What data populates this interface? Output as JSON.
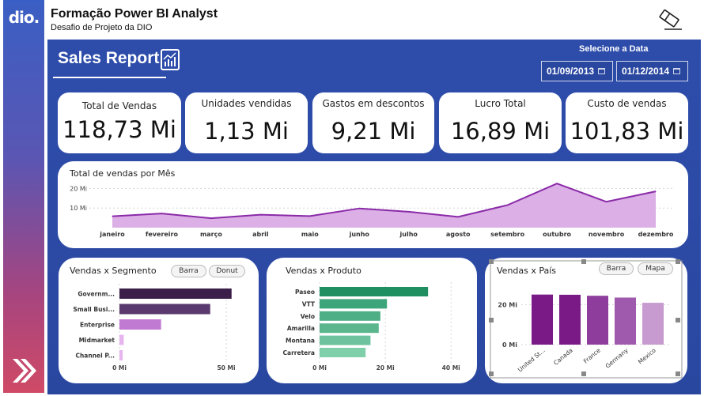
{
  "header": {
    "title": "Formação Power BI Analyst",
    "subtitle": "Desafio de Projeto da DIO",
    "logo_text": "dio."
  },
  "report": {
    "title": "Sales Report"
  },
  "date_filter": {
    "label": "Selecione a Data",
    "start": "01/09/2013",
    "end": "01/12/2014"
  },
  "kpis": [
    {
      "label": "Total de Vendas",
      "value": "118,73 Mi"
    },
    {
      "label": "Unidades vendidas",
      "value": "1,13 Mi"
    },
    {
      "label": "Gastos em descontos",
      "value": "9,21 Mi"
    },
    {
      "label": "Lucro Total",
      "value": "16,89 Mi"
    },
    {
      "label": "Custo de vendas",
      "value": "101,83 Mi"
    }
  ],
  "colors": {
    "accent_purple": "#8a2aa8",
    "area_fill": "#d8a6e3",
    "canvas_blue": "#2c4ba6"
  },
  "chart_data": [
    {
      "type": "area",
      "title": "Total de vendas por Mês",
      "categories": [
        "janeiro",
        "fevereiro",
        "março",
        "abril",
        "maio",
        "junho",
        "julho",
        "agosto",
        "setembro",
        "outubro",
        "novembro",
        "dezembro"
      ],
      "values": [
        5.8,
        7.2,
        4.8,
        6.6,
        5.9,
        9.8,
        8.1,
        5.5,
        11.5,
        22.5,
        13.2,
        18.5
      ],
      "ylim": [
        0,
        25
      ],
      "yticks": [
        {
          "v": 10,
          "label": "10 Mi"
        },
        {
          "v": 20,
          "label": "20 Mi"
        }
      ]
    },
    {
      "type": "bar",
      "orientation": "horizontal",
      "title": "Vendas x Segmento",
      "buttons": [
        "Barra",
        "Donut"
      ],
      "categories": [
        "Governm...",
        "Small Busi...",
        "Enterprise",
        "Midmarket",
        "Channel P..."
      ],
      "values": [
        52.5,
        42.5,
        19.5,
        2.0,
        1.5
      ],
      "colors": [
        "#3b1f4a",
        "#5a3a6e",
        "#c07ad1",
        "#e8b4f0",
        "#e8b4f0"
      ],
      "xlim": [
        0,
        60
      ],
      "xticks": [
        {
          "v": 0,
          "label": "0 Mi"
        },
        {
          "v": 50,
          "label": "50 Mi"
        }
      ]
    },
    {
      "type": "bar",
      "orientation": "horizontal",
      "title": "Vendas x Produto",
      "categories": [
        "Paseo",
        "VTT",
        "Velo",
        "Amarilla",
        "Montana",
        "Carretera"
      ],
      "values": [
        33.0,
        20.5,
        18.5,
        18.0,
        15.5,
        14.0
      ],
      "colors": [
        "#1f8f62",
        "#3da57a",
        "#4eae86",
        "#5bb68e",
        "#6ec39e",
        "#7ecfaa"
      ],
      "xlim": [
        0,
        45
      ],
      "xticks": [
        {
          "v": 0,
          "label": "0 Mi"
        },
        {
          "v": 20,
          "label": "20 Mi"
        },
        {
          "v": 40,
          "label": "40 Mi"
        }
      ]
    },
    {
      "type": "bar",
      "title": "Vendas x País",
      "buttons": [
        "Barra",
        "Mapa"
      ],
      "categories": [
        "United St...",
        "Canada",
        "France",
        "Germany",
        "Mexico"
      ],
      "values": [
        25.0,
        24.9,
        24.4,
        23.5,
        20.9
      ],
      "colors": [
        "#7a1a86",
        "#7a1a86",
        "#8e3d9c",
        "#a05aad",
        "#c89bd0"
      ],
      "ylim": [
        0,
        30
      ],
      "yticks": [
        {
          "v": 0,
          "label": "0 Mi"
        },
        {
          "v": 20,
          "label": "20 Mi"
        }
      ]
    }
  ]
}
